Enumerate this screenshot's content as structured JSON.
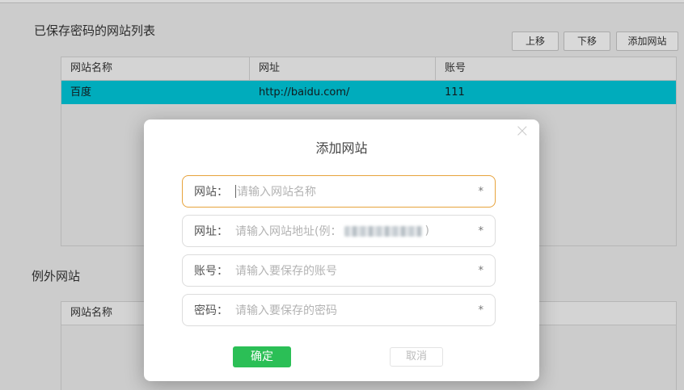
{
  "colors": {
    "selected-row": "#00cbdd",
    "accent-green": "#2bbf56",
    "focus-border": "#e7a33c"
  },
  "saved_section": {
    "title": "已保存密码的网站列表",
    "move_up_label": "上移",
    "move_down_label": "下移",
    "add_site_label": "添加网站",
    "table": {
      "headers": [
        "网站名称",
        "网址",
        "账号"
      ],
      "row": {
        "name": "百度",
        "url": "http://baidu.com/",
        "account": "111"
      }
    }
  },
  "exception_section": {
    "title": "例外网站",
    "table": {
      "headers": [
        "网站名称"
      ]
    }
  },
  "dialog": {
    "title": "添加网站",
    "close_icon": "×",
    "fields": [
      {
        "label": "网站：",
        "placeholder": "请输入网站名称",
        "required": "*"
      },
      {
        "label": "网址：",
        "placeholder_prefix": "请输入网站地址(例：",
        "placeholder_suffix": ")",
        "required": "*"
      },
      {
        "label": "账号：",
        "placeholder": "请输入要保存的账号",
        "required": "*"
      },
      {
        "label": "密码：",
        "placeholder": "请输入要保存的密码",
        "required": "*"
      }
    ],
    "confirm_label": "确定",
    "cancel_label": "取消"
  }
}
